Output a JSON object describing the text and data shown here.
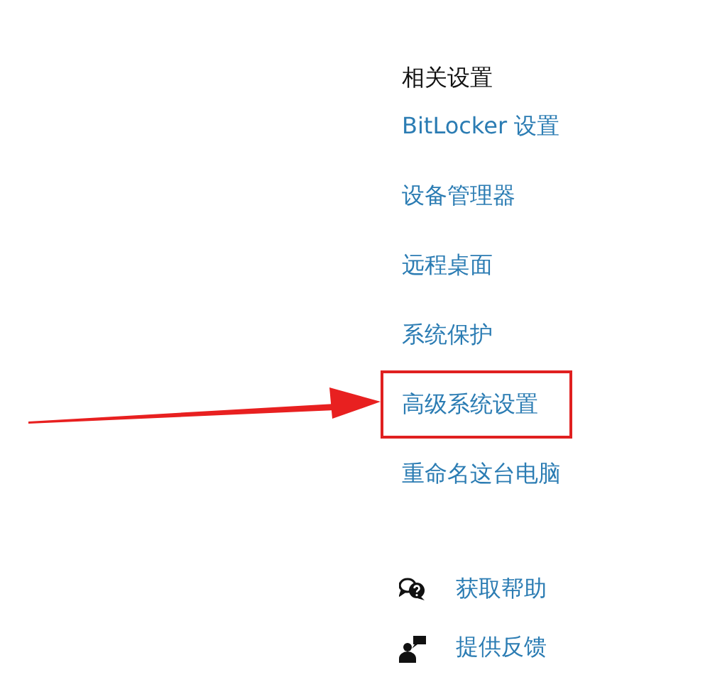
{
  "related_settings": {
    "heading": "相关设置",
    "links": [
      {
        "label": "BitLocker 设置",
        "highlighted": false
      },
      {
        "label": "设备管理器",
        "highlighted": false
      },
      {
        "label": "远程桌面",
        "highlighted": false
      },
      {
        "label": "系统保护",
        "highlighted": false
      },
      {
        "label": "高级系统设置",
        "highlighted": true
      },
      {
        "label": "重命名这台电脑",
        "highlighted": false
      }
    ]
  },
  "support": [
    {
      "kind": "help",
      "label": "获取帮助"
    },
    {
      "kind": "feedback",
      "label": "提供反馈"
    }
  ],
  "annotation": {
    "arrow": true
  }
}
